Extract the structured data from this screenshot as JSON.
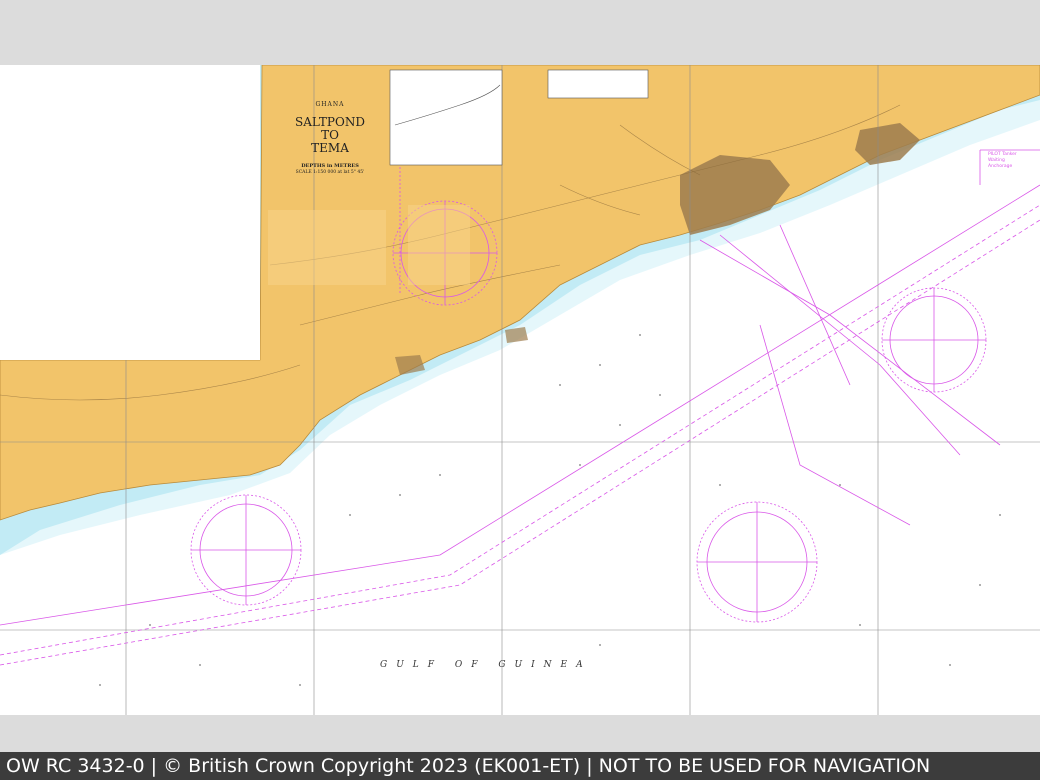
{
  "footer": {
    "text": "OW RC 3432-0 | © British Crown Copyright 2023 (EK001-ET) | NOT TO BE USED FOR NAVIGATION"
  },
  "title_block": {
    "country": "GHANA",
    "title_line1": "SALTPOND",
    "title_line2": "TO",
    "title_line3": "TEMA",
    "depths": "DEPTHS in METRES",
    "scale": "SCALE 1:150 000 at lat 5° 45'"
  },
  "labels": {
    "sea_name": "GULF OF GUINEA",
    "anchorage_1": "PILOT Tanker",
    "anchorage_2": "Waiting",
    "anchorage_3": "Anchorage"
  },
  "colors": {
    "land": "#f2c46a",
    "urban": "#9e7d4e",
    "shallow_water": "#a8e2f0",
    "deep_water": "#ffffff",
    "magenta": "#d957e8",
    "grid": "#8b8b8b",
    "footer_bg": "#3c3c3c",
    "frame_bg": "#dcdcdc"
  }
}
